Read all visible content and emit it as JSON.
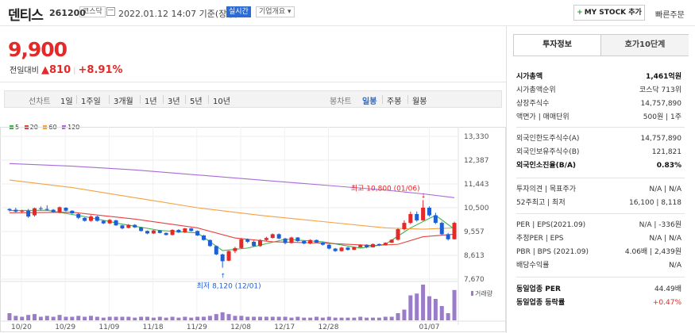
{
  "header": {
    "name": "덴티스",
    "code": "261200",
    "market": "코스닥",
    "datetime": "2022.01.12 14:07 기준(장중)",
    "realtime": "실시간",
    "company": "기업개요 ▾",
    "mystock": "MY STOCK 추가",
    "fast_order": "빠른주문"
  },
  "price": {
    "current": "9,900",
    "change_label": "전일대비",
    "change": "▲810",
    "change_pct": "+8.91%"
  },
  "periods": {
    "chart_label": "선차트",
    "items": [
      "1일",
      "1주일",
      "3개월",
      "1년",
      "3년",
      "5년",
      "10년"
    ],
    "candle_label": "봉차트",
    "candle_items": [
      "일봉",
      "주봉",
      "월봉"
    ],
    "active": "일봉"
  },
  "legend": [
    {
      "label": "5",
      "color": "#3cb44b"
    },
    {
      "label": "20",
      "color": "#e8413c"
    },
    {
      "label": "60",
      "color": "#f5a142"
    },
    {
      "label": "120",
      "color": "#a86ad8"
    }
  ],
  "chart_data": {
    "type": "candlestick",
    "y_ticks": [
      "13,330",
      "12,387",
      "11,443",
      "10,500",
      "9,557",
      "8,613",
      "7,670"
    ],
    "x_ticks": [
      "10/20",
      "10/29",
      "11/09",
      "11/18",
      "11/29",
      "12/08",
      "12/17",
      "12/28",
      "01/07"
    ],
    "ylim": [
      7670,
      13330
    ],
    "high_annotation": "최고 10,800 (01/06)",
    "low_annotation": "최저 8,120 (12/01)",
    "volume_label": "거래량",
    "candles": [
      [
        10450,
        10480,
        10350,
        10400
      ],
      [
        10420,
        10500,
        10300,
        10350
      ],
      [
        10350,
        10420,
        10280,
        10380
      ],
      [
        10380,
        10450,
        10100,
        10150
      ],
      [
        10200,
        10500,
        10150,
        10480
      ],
      [
        10480,
        10550,
        10400,
        10450
      ],
      [
        10450,
        10600,
        10380,
        10420
      ],
      [
        10420,
        10450,
        10300,
        10330
      ],
      [
        10300,
        10550,
        10280,
        10520
      ],
      [
        10500,
        10520,
        10350,
        10380
      ],
      [
        10380,
        10400,
        10250,
        10280
      ],
      [
        10250,
        10280,
        10050,
        10100
      ],
      [
        10100,
        10120,
        9950,
        9980
      ],
      [
        9980,
        10200,
        9950,
        10150
      ],
      [
        10150,
        10180,
        9950,
        9980
      ],
      [
        9980,
        10000,
        9850,
        9880
      ],
      [
        9880,
        10050,
        9850,
        10020
      ],
      [
        10000,
        10020,
        9780,
        9800
      ],
      [
        9800,
        9820,
        9650,
        9680
      ],
      [
        9700,
        9850,
        9680,
        9820
      ],
      [
        9820,
        9850,
        9700,
        9720
      ],
      [
        9720,
        9740,
        9550,
        9580
      ],
      [
        9580,
        9600,
        9450,
        9480
      ],
      [
        9480,
        9620,
        9460,
        9600
      ],
      [
        9600,
        9620,
        9480,
        9500
      ],
      [
        9500,
        9520,
        9400,
        9420
      ],
      [
        9420,
        9650,
        9400,
        9620
      ],
      [
        9620,
        9650,
        9500,
        9520
      ],
      [
        9520,
        9700,
        9500,
        9680
      ],
      [
        9680,
        9700,
        9550,
        9580
      ],
      [
        9580,
        9600,
        9380,
        9400
      ],
      [
        9400,
        9420,
        9200,
        9220
      ],
      [
        9220,
        9240,
        8950,
        8980
      ],
      [
        8980,
        9000,
        8620,
        8650
      ],
      [
        8650,
        8680,
        8120,
        8380
      ],
      [
        8400,
        8800,
        8380,
        8780
      ],
      [
        8780,
        8950,
        8700,
        8900
      ],
      [
        8900,
        9300,
        8880,
        9250
      ],
      [
        9250,
        9280,
        9100,
        9150
      ],
      [
        9150,
        9200,
        8950,
        8980
      ],
      [
        8980,
        9250,
        8950,
        9220
      ],
      [
        9220,
        9350,
        9180,
        9300
      ],
      [
        9300,
        9480,
        9280,
        9450
      ],
      [
        9450,
        9480,
        9250,
        9280
      ],
      [
        9280,
        9300,
        9050,
        9100
      ],
      [
        9100,
        9350,
        9080,
        9320
      ],
      [
        9320,
        9340,
        9150,
        9180
      ],
      [
        9180,
        9200,
        9050,
        9080
      ],
      [
        9080,
        9250,
        9050,
        9220
      ],
      [
        9220,
        9240,
        9100,
        9120
      ],
      [
        9120,
        9140,
        9000,
        9030
      ],
      [
        9030,
        9060,
        8850,
        8880
      ],
      [
        8880,
        8900,
        8750,
        8780
      ],
      [
        8780,
        8950,
        8760,
        8920
      ],
      [
        8920,
        8950,
        8800,
        8830
      ],
      [
        8830,
        8950,
        8820,
        8930
      ],
      [
        8930,
        9050,
        8920,
        9030
      ],
      [
        9030,
        9050,
        8900,
        8930
      ],
      [
        8930,
        9080,
        8920,
        9060
      ],
      [
        9060,
        9080,
        8980,
        9010
      ],
      [
        9010,
        9130,
        9000,
        9110
      ],
      [
        9110,
        9250,
        9100,
        9230
      ],
      [
        9230,
        9700,
        9200,
        9650
      ],
      [
        9650,
        10000,
        9600,
        9900
      ],
      [
        9900,
        10350,
        9850,
        10250
      ],
      [
        10250,
        10350,
        9950,
        10000
      ],
      [
        10000,
        10800,
        9980,
        10500
      ],
      [
        10500,
        10550,
        10150,
        10200
      ],
      [
        10200,
        10300,
        9850,
        9900
      ],
      [
        9900,
        9950,
        9400,
        9450
      ],
      [
        9450,
        9500,
        9200,
        9250
      ],
      [
        9250,
        9950,
        9240,
        9900
      ]
    ],
    "volumes": [
      8,
      5,
      4,
      6,
      7,
      4,
      5,
      4,
      6,
      4,
      4,
      5,
      4,
      5,
      4,
      3,
      4,
      4,
      4,
      4,
      3,
      4,
      4,
      3,
      4,
      3,
      4,
      3,
      4,
      3,
      4,
      4,
      5,
      7,
      9,
      7,
      5,
      5,
      4,
      4,
      4,
      4,
      4,
      4,
      4,
      3,
      4,
      3,
      3,
      4,
      3,
      4,
      3,
      3,
      3,
      3,
      4,
      3,
      3,
      3,
      4,
      4,
      8,
      12,
      28,
      30,
      40,
      27,
      24,
      16,
      8,
      34
    ],
    "ma_lines": {
      "ma5": [
        [
          0,
          10390
        ],
        [
          6,
          10400
        ],
        [
          12,
          10150
        ],
        [
          18,
          9850
        ],
        [
          24,
          9600
        ],
        [
          30,
          9500
        ],
        [
          34,
          8800
        ],
        [
          38,
          8900
        ],
        [
          44,
          9250
        ],
        [
          50,
          9150
        ],
        [
          56,
          8900
        ],
        [
          60,
          9050
        ],
        [
          64,
          9700
        ],
        [
          68,
          10200
        ],
        [
          71,
          9650
        ]
      ],
      "ma20": [
        [
          0,
          10300
        ],
        [
          10,
          10320
        ],
        [
          20,
          10050
        ],
        [
          30,
          9700
        ],
        [
          36,
          9300
        ],
        [
          42,
          9150
        ],
        [
          50,
          9100
        ],
        [
          58,
          9000
        ],
        [
          62,
          9050
        ],
        [
          66,
          9350
        ],
        [
          71,
          9450
        ]
      ],
      "ma60": [
        [
          0,
          11600
        ],
        [
          10,
          11300
        ],
        [
          20,
          10900
        ],
        [
          30,
          10500
        ],
        [
          40,
          10200
        ],
        [
          50,
          9950
        ],
        [
          60,
          9700
        ],
        [
          66,
          9650
        ],
        [
          71,
          9700
        ]
      ],
      "ma120": [
        [
          0,
          12250
        ],
        [
          10,
          12150
        ],
        [
          20,
          12000
        ],
        [
          30,
          11800
        ],
        [
          40,
          11600
        ],
        [
          50,
          11400
        ],
        [
          60,
          11200
        ],
        [
          66,
          11050
        ],
        [
          71,
          10900
        ]
      ]
    }
  },
  "tabs": {
    "invest": "투자정보",
    "quote": "호가10단계"
  },
  "info": {
    "g1": [
      {
        "k": "시가총액",
        "v": "1,461억원",
        "bold": true
      },
      {
        "k": "시가총액순위",
        "v": "코스닥 713위"
      },
      {
        "k": "상장주식수",
        "v": "14,757,890"
      },
      {
        "k": "액면가 | 매매단위",
        "v": "500원 | 1주"
      }
    ],
    "g2": [
      {
        "k": "외국인한도주식수(A)",
        "v": "14,757,890"
      },
      {
        "k": "외국인보유주식수(B)",
        "v": "121,821"
      },
      {
        "k": "외국인소진율(B/A)",
        "v": "0.83%",
        "bold": true
      }
    ],
    "g3": [
      {
        "k": "투자의견 | 목표주가",
        "v": "N/A | N/A"
      },
      {
        "k": "52주최고 | 최저",
        "v": "16,100 | 8,118"
      }
    ],
    "g4": [
      {
        "k": "PER | EPS(2021.09)",
        "v": "N/A | -336원"
      },
      {
        "k": "추정PER | EPS",
        "v": "N/A | N/A"
      },
      {
        "k": "PBR | BPS (2021.09)",
        "v": "4.06배 | 2,439원"
      },
      {
        "k": "배당수익률",
        "v": "N/A"
      }
    ],
    "g5": [
      {
        "k": "동일업종 PER",
        "v": "44.49배"
      },
      {
        "k": "동일업종 등락률",
        "v": "+0.47%",
        "red": true
      }
    ]
  }
}
